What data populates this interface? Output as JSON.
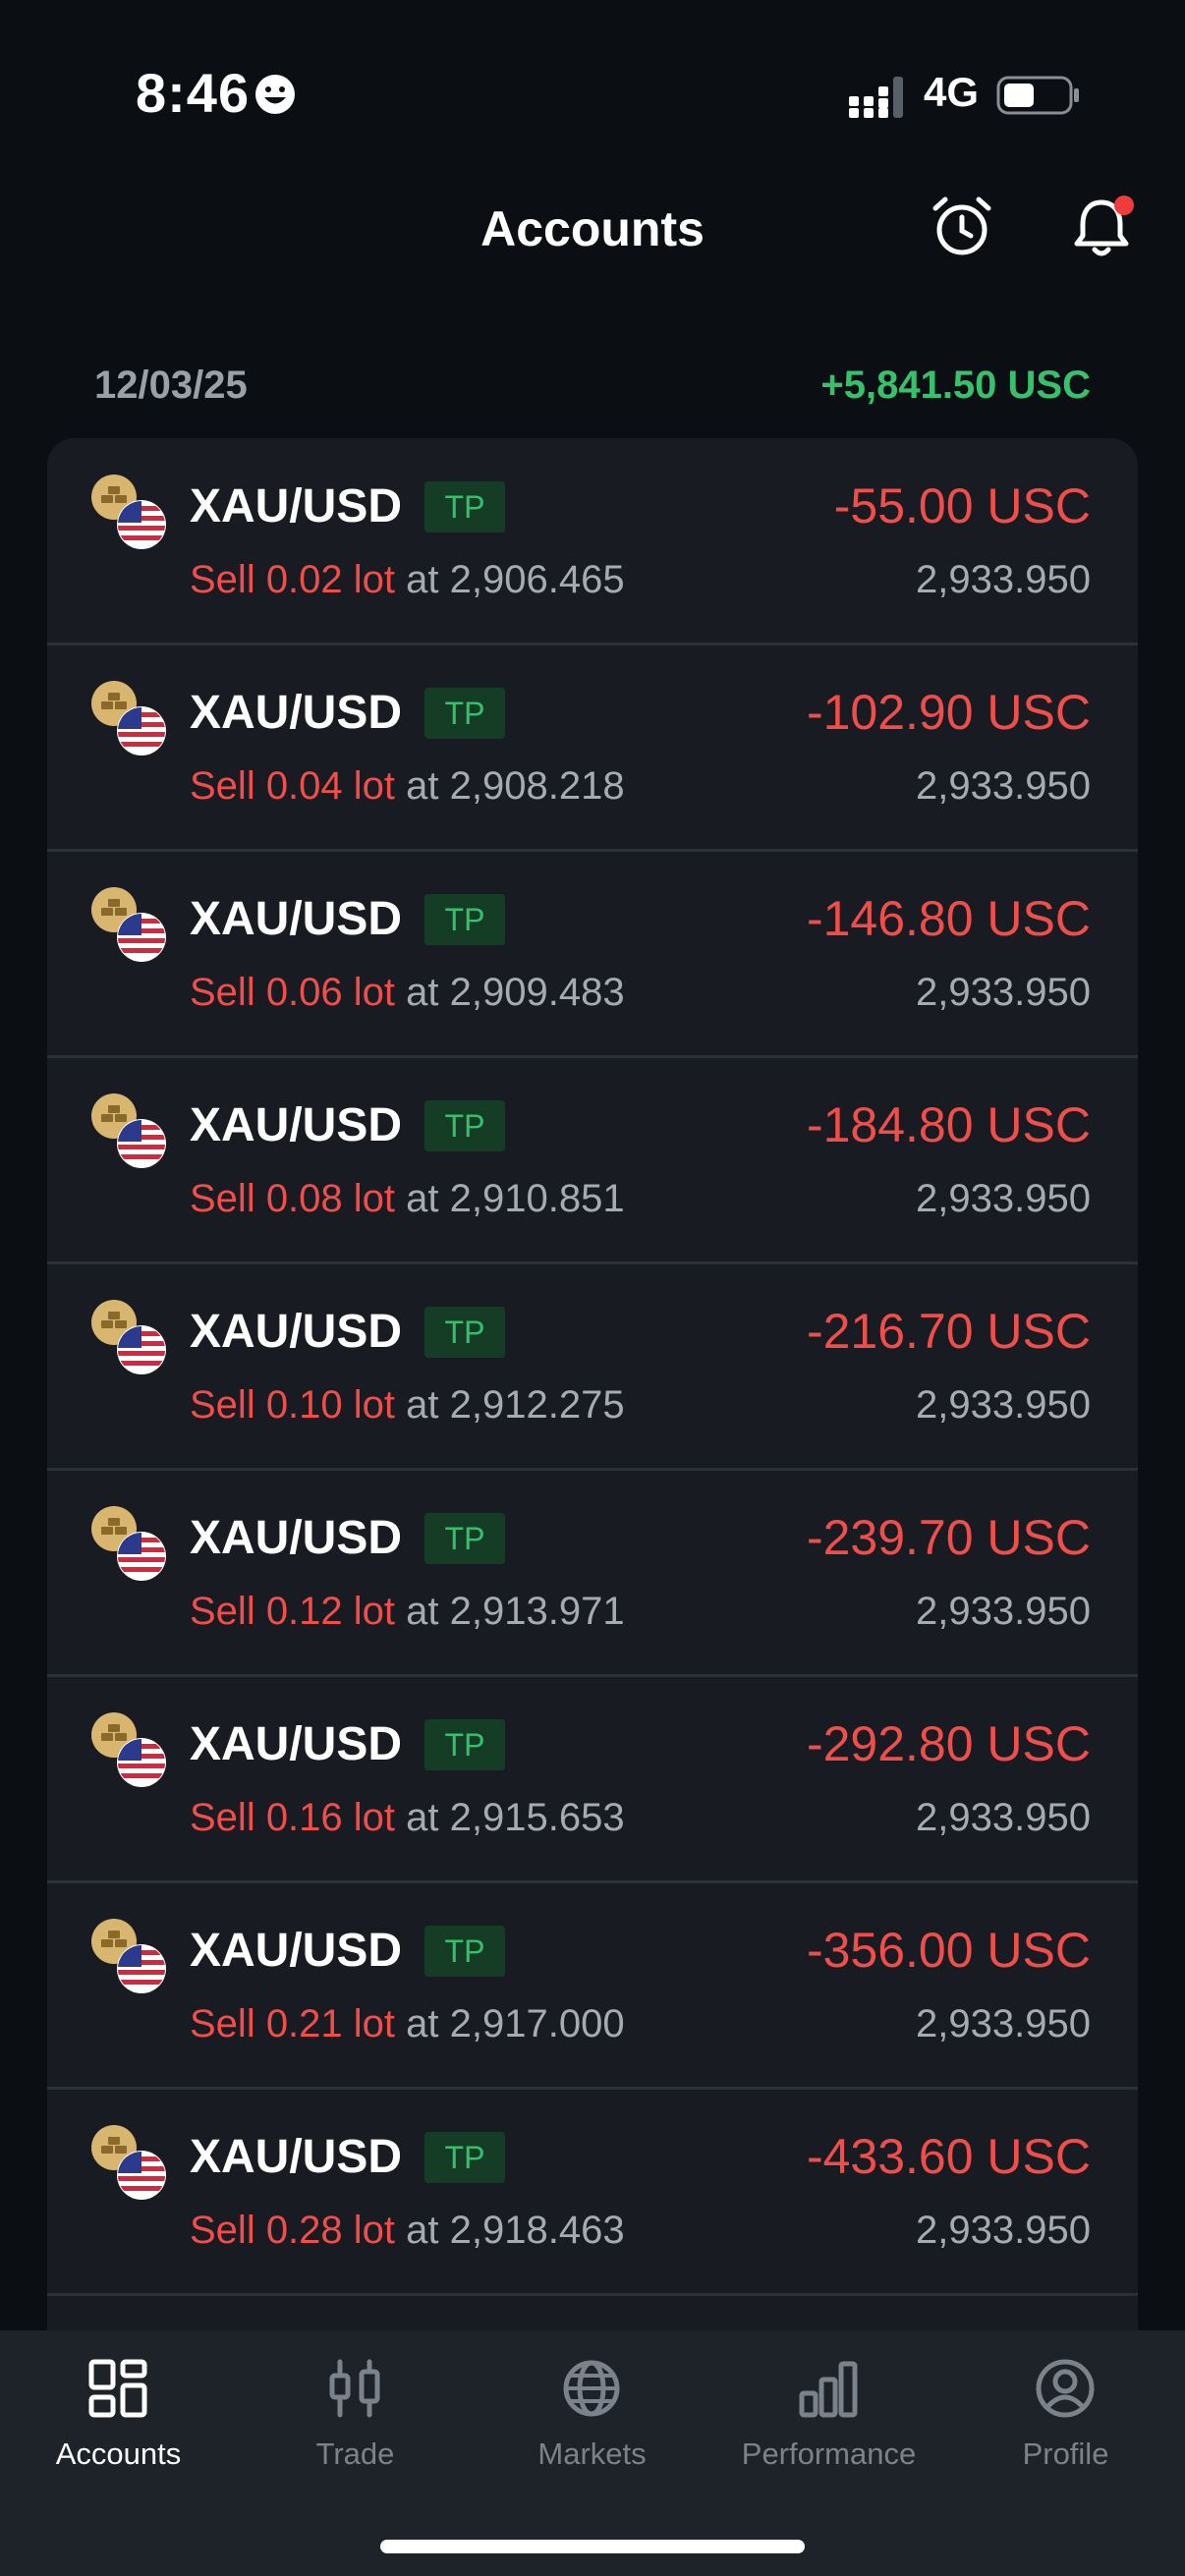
{
  "status_bar": {
    "time": "8:46",
    "network": "4G"
  },
  "header": {
    "title": "Accounts"
  },
  "summary": {
    "date": "12/03/25",
    "total": "+5,841.50 USC"
  },
  "colors": {
    "profit": "#39c06c",
    "loss": "#ef4e4a",
    "background": "#0b0e13",
    "card": "#181c22"
  },
  "positions": [
    {
      "symbol": "XAU/USD",
      "badge": "TP",
      "side": "Sell 0.02 lot",
      "at": "at 2,906.465",
      "pnl": "-55.00 USC",
      "current": "2,933.950"
    },
    {
      "symbol": "XAU/USD",
      "badge": "TP",
      "side": "Sell 0.04 lot",
      "at": "at 2,908.218",
      "pnl": "-102.90 USC",
      "current": "2,933.950"
    },
    {
      "symbol": "XAU/USD",
      "badge": "TP",
      "side": "Sell 0.06 lot",
      "at": "at 2,909.483",
      "pnl": "-146.80 USC",
      "current": "2,933.950"
    },
    {
      "symbol": "XAU/USD",
      "badge": "TP",
      "side": "Sell 0.08 lot",
      "at": "at 2,910.851",
      "pnl": "-184.80 USC",
      "current": "2,933.950"
    },
    {
      "symbol": "XAU/USD",
      "badge": "TP",
      "side": "Sell 0.10 lot",
      "at": "at 2,912.275",
      "pnl": "-216.70 USC",
      "current": "2,933.950"
    },
    {
      "symbol": "XAU/USD",
      "badge": "TP",
      "side": "Sell 0.12 lot",
      "at": "at 2,913.971",
      "pnl": "-239.70 USC",
      "current": "2,933.950"
    },
    {
      "symbol": "XAU/USD",
      "badge": "TP",
      "side": "Sell 0.16 lot",
      "at": "at 2,915.653",
      "pnl": "-292.80 USC",
      "current": "2,933.950"
    },
    {
      "symbol": "XAU/USD",
      "badge": "TP",
      "side": "Sell 0.21 lot",
      "at": "at 2,917.000",
      "pnl": "-356.00 USC",
      "current": "2,933.950"
    },
    {
      "symbol": "XAU/USD",
      "badge": "TP",
      "side": "Sell 0.28 lot",
      "at": "at 2,918.463",
      "pnl": "-433.60 USC",
      "current": "2,933.950"
    }
  ],
  "tabs": [
    {
      "label": "Accounts",
      "icon": "grid-icon",
      "active": true
    },
    {
      "label": "Trade",
      "icon": "candlestick-icon",
      "active": false
    },
    {
      "label": "Markets",
      "icon": "globe-icon",
      "active": false
    },
    {
      "label": "Performance",
      "icon": "bar-chart-icon",
      "active": false
    },
    {
      "label": "Profile",
      "icon": "user-circle-icon",
      "active": false
    }
  ]
}
